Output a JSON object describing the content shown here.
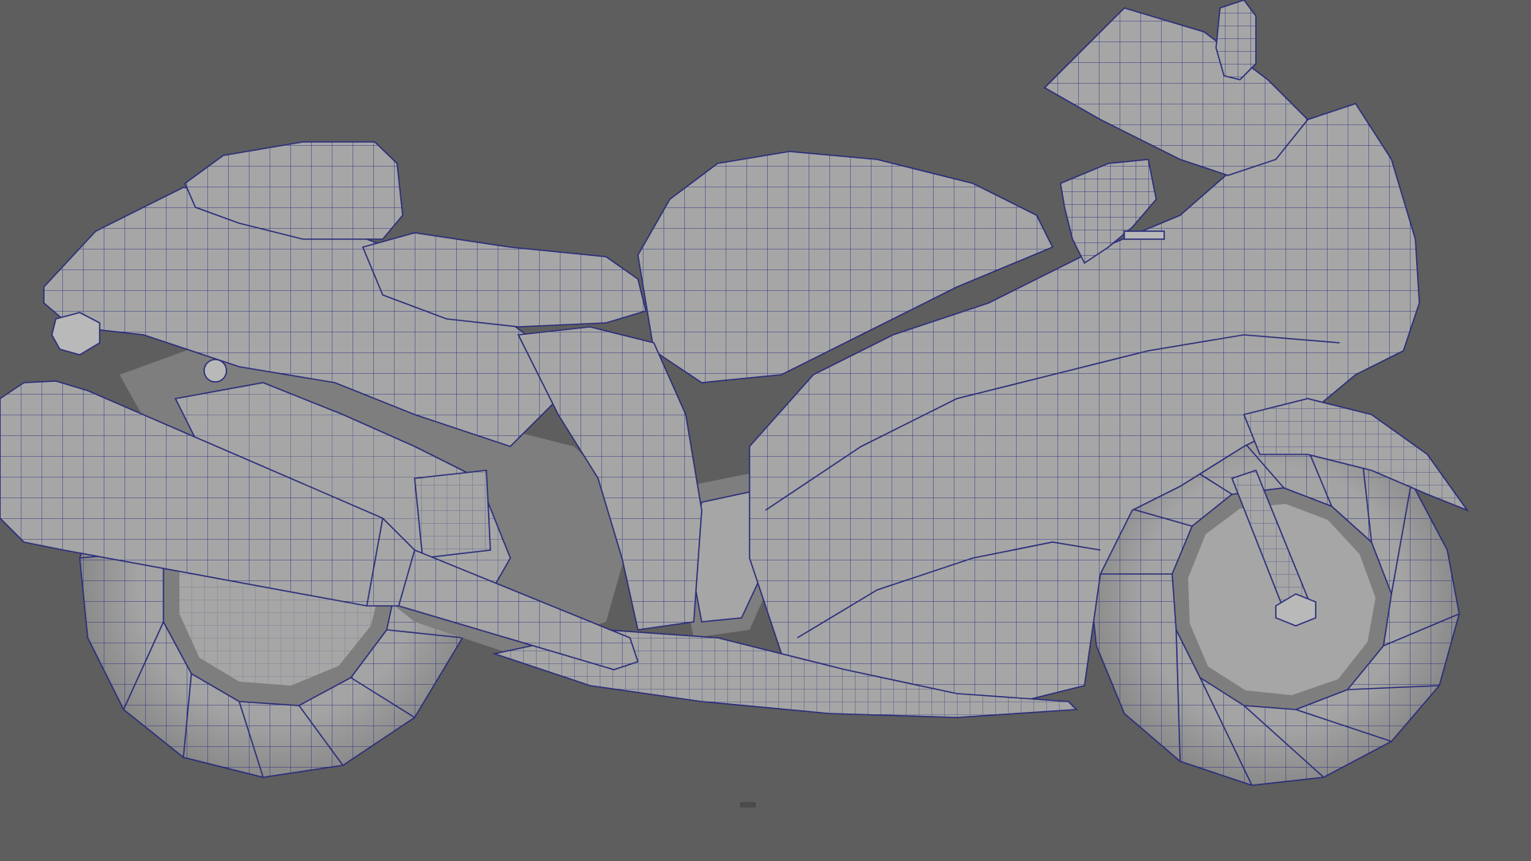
{
  "viewport": {
    "background_color": "#5e5e5e",
    "model_fill_color": "#a6a6a6",
    "model_shadow_color": "#7e7e7e",
    "wireframe_color": "#2b2e7a",
    "subject": "motorcycle-model-wireframe-on-shaded"
  }
}
